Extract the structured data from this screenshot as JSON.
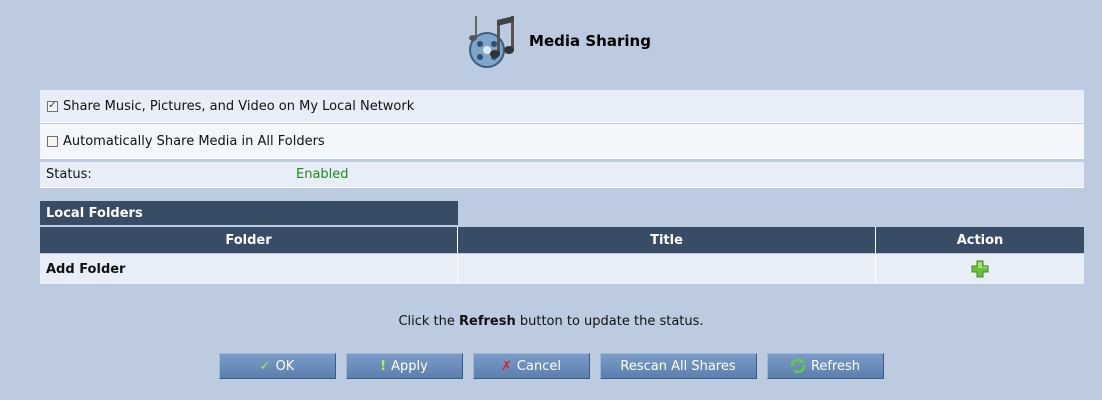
{
  "header": {
    "title": "Media Sharing",
    "icon": "media-sharing-icon"
  },
  "options": {
    "share_label": "Share Music, Pictures, and Video on My Local Network",
    "share_checked": true,
    "auto_label": "Automatically Share Media in All Folders",
    "auto_checked": false
  },
  "status": {
    "label": "Status:",
    "value": "Enabled",
    "value_color": "#1d8a1d"
  },
  "local_folders": {
    "section_title": "Local Folders",
    "columns": [
      "Folder",
      "Title",
      "Action"
    ],
    "rows": [
      {
        "folder": "Add Folder",
        "title": "",
        "action_icon": "add-icon"
      }
    ]
  },
  "info": {
    "prefix": "Click the ",
    "bold": "Refresh",
    "suffix": " button to update the status."
  },
  "buttons": {
    "ok": "OK",
    "apply": "Apply",
    "cancel": "Cancel",
    "rescan": "Rescan All Shares",
    "refresh": "Refresh"
  },
  "colors": {
    "background": "#bccbe0",
    "header_dark": "#384c66",
    "button": "#6b8fbf"
  }
}
